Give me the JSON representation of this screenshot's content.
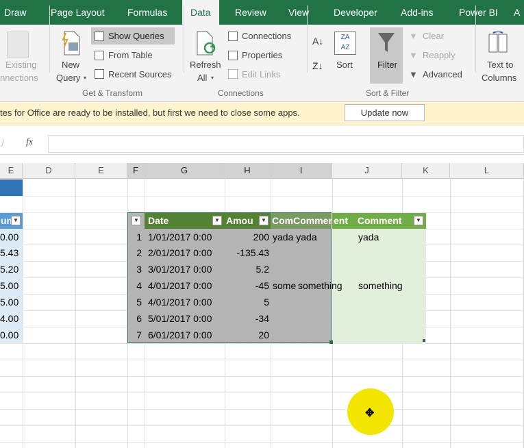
{
  "tabs": [
    "Draw",
    "Page Layout",
    "Formulas",
    "Data",
    "Review",
    "View",
    "Developer",
    "Add-ins",
    "Power BI",
    "A"
  ],
  "ribbon": {
    "existing_connections": [
      "Existing",
      "nnections"
    ],
    "new_query": [
      "New",
      "Query"
    ],
    "show_queries": "Show Queries",
    "from_table": "From Table",
    "recent_sources": "Recent Sources",
    "group_get_transform": "Get & Transform",
    "refresh_all": [
      "Refresh",
      "All"
    ],
    "connections": "Connections",
    "properties": "Properties",
    "edit_links": "Edit Links",
    "group_connections": "Connections",
    "sort": "Sort",
    "filter": "Filter",
    "clear": "Clear",
    "reapply": "Reapply",
    "advanced": "Advanced",
    "group_sort_filter": "Sort & Filter",
    "text_to_columns": [
      "Text to",
      "Columns"
    ]
  },
  "message_bar": {
    "text": "tes for Office are ready to be installed, but first we need to close some apps.",
    "button": "Update now"
  },
  "formula_bar": {
    "fx": "fx",
    "x_mark": "/"
  },
  "columns": [
    "E",
    "D",
    "E",
    "F",
    "G",
    "H",
    "I",
    "J",
    "K",
    "L"
  ],
  "left_column": {
    "header_fragment": "un",
    "values": [
      "0.00",
      "5.43",
      "5.20",
      "5.00",
      "5.00",
      "4.00",
      "0.00"
    ]
  },
  "table1": {
    "headers": [
      "Date",
      "Amou",
      "Com",
      "Comment"
    ],
    "rows": [
      {
        "idx": "1",
        "date": "1/01/2017 0:00",
        "amount": "200",
        "com": "yada yada"
      },
      {
        "idx": "2",
        "date": "2/01/2017 0:00",
        "amount": "-135.43",
        "com": ""
      },
      {
        "idx": "3",
        "date": "3/01/2017 0:00",
        "amount": "5.2",
        "com": ""
      },
      {
        "idx": "4",
        "date": "4/01/2017 0:00",
        "amount": "-45",
        "com": "some"
      },
      {
        "idx": "5",
        "date": "4/01/2017 0:00",
        "amount": "5",
        "com": ""
      },
      {
        "idx": "6",
        "date": "5/01/2017 0:00",
        "amount": "-34",
        "com": ""
      },
      {
        "idx": "7",
        "date": "6/01/2017 0:00",
        "amount": "20",
        "com": ""
      }
    ]
  },
  "table2": {
    "header_fragment": "ent",
    "header": "Comment",
    "values": [
      "yada",
      "",
      "",
      "something",
      "",
      "",
      ""
    ],
    "overflow": "something"
  },
  "colors": {
    "excel_green": "#217346",
    "table_header": "#70ad47",
    "band": "#e2efda",
    "selection": "#b3b3b3",
    "cursor": "#f2e600",
    "message": "#fff4ce"
  }
}
